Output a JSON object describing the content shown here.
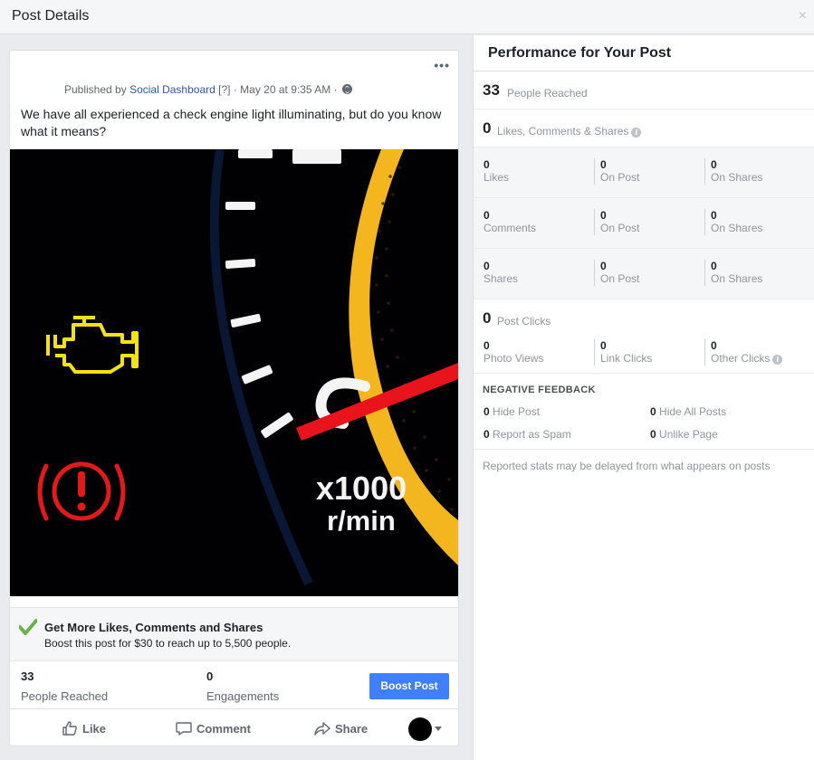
{
  "dialog": {
    "title": "Post Details",
    "close_glyph": "×"
  },
  "post": {
    "menu_glyph": "•••",
    "published_prefix": "Published by",
    "page_name": "Social Dashboard",
    "help_marker": "[?]",
    "sep1": "·",
    "date": "May 20 at 9:35 AM",
    "sep2": "·",
    "privacy_icon": "globe-icon",
    "text": "We have all experienced a check engine light illuminating, but do you know what it means?",
    "image": {
      "overlay_text_line1": "x1000",
      "overlay_text_line2": "r/min",
      "colors": {
        "background": "#010103",
        "engine_light": "#f3e20e",
        "brake_light": "#e21a1a",
        "needle": "#e8131b",
        "dial_arc": "#f4b61e"
      }
    },
    "promo": {
      "title": "Get More Likes, Comments and Shares",
      "subtitle": "Boost this post for $30 to reach up to 5,500 people.",
      "icon": "checkmark-icon"
    },
    "stats": {
      "reached_value": "33",
      "reached_label": "People Reached",
      "engagements_value": "0",
      "engagements_label": "Engagements"
    },
    "boost_label": "Boost Post",
    "actions": {
      "like": "Like",
      "comment": "Comment",
      "share": "Share"
    }
  },
  "performance": {
    "title": "Performance for Your Post",
    "reached": {
      "value": "33",
      "label": "People Reached"
    },
    "engagement": {
      "value": "0",
      "label": "Likes, Comments & Shares"
    },
    "grid": [
      {
        "cells": [
          {
            "value": "0",
            "label": "Likes"
          },
          {
            "value": "0",
            "label": "On Post"
          },
          {
            "value": "0",
            "label": "On Shares"
          }
        ]
      },
      {
        "cells": [
          {
            "value": "0",
            "label": "Comments"
          },
          {
            "value": "0",
            "label": "On Post"
          },
          {
            "value": "0",
            "label": "On Shares"
          }
        ]
      },
      {
        "cells": [
          {
            "value": "0",
            "label": "Shares"
          },
          {
            "value": "0",
            "label": "On Post"
          },
          {
            "value": "0",
            "label": "On Shares"
          }
        ]
      }
    ],
    "clicks": {
      "value": "0",
      "label": "Post Clicks",
      "cells": [
        {
          "value": "0",
          "label": "Photo Views"
        },
        {
          "value": "0",
          "label": "Link Clicks"
        },
        {
          "value": "0",
          "label": "Other Clicks"
        }
      ]
    },
    "negative": {
      "title": "NEGATIVE FEEDBACK",
      "items": [
        {
          "value": "0",
          "label": "Hide Post"
        },
        {
          "value": "0",
          "label": "Hide All Posts"
        },
        {
          "value": "0",
          "label": "Report as Spam"
        },
        {
          "value": "0",
          "label": "Unlike Page"
        }
      ]
    },
    "disclaimer": "Reported stats may be delayed from what appears on posts"
  },
  "colors": {
    "accent": "#4080ff",
    "link": "#365899",
    "check_green": "#67b348"
  }
}
